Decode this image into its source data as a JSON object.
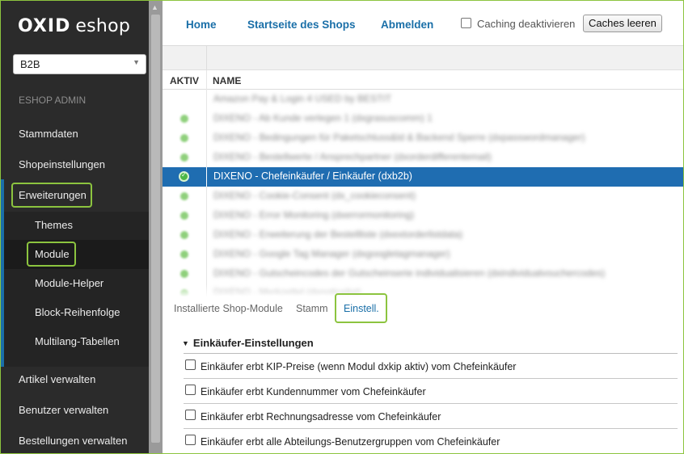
{
  "brand": {
    "logo_bold": "OXID",
    "logo_rest": "eshop"
  },
  "sidebar": {
    "shop_select": {
      "value": "B2B"
    },
    "section_label": "ESHOP ADMIN",
    "items": [
      {
        "label": "Stammdaten"
      },
      {
        "label": "Shopeinstellungen"
      },
      {
        "label": "Erweiterungen"
      },
      {
        "label": "Themes"
      },
      {
        "label": "Module"
      },
      {
        "label": "Module-Helper"
      },
      {
        "label": "Block-Reihenfolge"
      },
      {
        "label": "Multilang-Tabellen"
      },
      {
        "label": "Artikel verwalten"
      },
      {
        "label": "Benutzer verwalten"
      },
      {
        "label": "Bestellungen verwalten"
      }
    ]
  },
  "header": {
    "links": [
      {
        "label": "Home"
      },
      {
        "label": "Startseite des Shops"
      },
      {
        "label": "Abmelden"
      }
    ],
    "caching_label": "Caching deaktivieren",
    "caching_checked": false,
    "clear_cache_label": "Caches leeren"
  },
  "module_list": {
    "columns": {
      "active": "AKTIV",
      "name": "NAME"
    },
    "rows": [
      {
        "name": "Amazon Pay & Login 4 USED by BESTIT",
        "active": false,
        "selected": false
      },
      {
        "name": "DIXENO - Ab Kunde verlegen 1 (dxgrasuscomm) 1",
        "active": true,
        "selected": false
      },
      {
        "name": "DIXENO - Bedingungen für Paketschluss&ld & Backend Sperre (dxpasswordmanager)",
        "active": true,
        "selected": false
      },
      {
        "name": "DIXENO - Bestellwerte / Ansprechpartner (dxorderdifferentemail)",
        "active": true,
        "selected": false
      },
      {
        "name": "DIXENO - Chefeinkäufer / Einkäufer (dxb2b)",
        "active": true,
        "selected": true
      },
      {
        "name": "DIXENO - Cookie-Consent (dx_cookieconsent)",
        "active": true,
        "selected": false
      },
      {
        "name": "DIXENO - Error Monitoring (dxerrormonitoring)",
        "active": true,
        "selected": false
      },
      {
        "name": "DIXENO - Erweiterung der Bestellliste (dxextorderlistdata)",
        "active": true,
        "selected": false
      },
      {
        "name": "DIXENO - Google Tag Manager (dxgoogletagmanager)",
        "active": true,
        "selected": false
      },
      {
        "name": "DIXENO - Gutscheincodes der Gutscheinserie individualisieren (dxindividualvouchercodes)",
        "active": true,
        "selected": false
      },
      {
        "name": "DIXENO - Merkzettel (dxnoticelist)",
        "active": true,
        "selected": false
      }
    ]
  },
  "tabs": [
    {
      "label": "Installierte Shop-Module",
      "active": false
    },
    {
      "label": "Stamm",
      "active": false
    },
    {
      "label": "Einstell.",
      "active": true
    }
  ],
  "settings": {
    "group_title": "Einkäufer-Einstellungen",
    "options": [
      {
        "label": "Einkäufer erbt KIP-Preise (wenn Modul dxkip aktiv) vom Chefeinkäufer",
        "checked": false
      },
      {
        "label": "Einkäufer erbt Kundennummer vom Chefeinkäufer",
        "checked": false
      },
      {
        "label": "Einkäufer erbt Rechnungsadresse vom Chefeinkäufer",
        "checked": false
      },
      {
        "label": "Einkäufer erbt alle Abteilungs-Benutzergruppen vom Chefeinkäufer",
        "checked": false
      }
    ]
  },
  "colors": {
    "accent": "#1a6fa8",
    "highlight": "#8cc43f",
    "selected_row": "#1f6db1",
    "sidebar_bg": "#2b2b2b"
  }
}
